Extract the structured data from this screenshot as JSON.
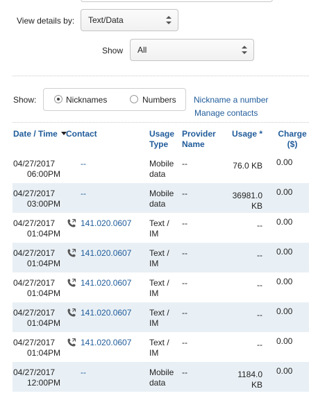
{
  "filters": {
    "view_details_label": "View details by:",
    "view_details_value": "Text/Data",
    "show_label": "Show",
    "show_value": "All"
  },
  "display": {
    "show_label": "Show:",
    "option_nicknames": "Nicknames",
    "option_numbers": "Numbers",
    "selected": "Nicknames",
    "link_nickname": "Nickname a number",
    "link_manage": "Manage contacts"
  },
  "table": {
    "headers": {
      "date_time": "Date / Time",
      "contact": "Contact",
      "usage_type_1": "Usage",
      "usage_type_2": "Type",
      "provider_1": "Provider",
      "provider_2": "Name",
      "usage": "Usage *",
      "charge_1": "Charge",
      "charge_2": "($)"
    },
    "rows": [
      {
        "date": "04/27/2017",
        "time": "06:00PM",
        "contact": "--",
        "type_1": "Mobile",
        "type_2": "data",
        "provider": "--",
        "usage_1": "76.0 KB",
        "usage_2": "",
        "charge": "0.00",
        "phone": false
      },
      {
        "date": "04/27/2017",
        "time": "03:00PM",
        "contact": "--",
        "type_1": "Mobile",
        "type_2": "data",
        "provider": "--",
        "usage_1": "36981.0",
        "usage_2": "KB",
        "charge": "0.00",
        "phone": false
      },
      {
        "date": "04/27/2017",
        "time": "01:04PM",
        "contact": "141.020.0607",
        "type_1": "Text /",
        "type_2": "IM",
        "provider": "--",
        "usage_1": "--",
        "usage_2": "",
        "charge": "0.00",
        "phone": true
      },
      {
        "date": "04/27/2017",
        "time": "01:04PM",
        "contact": "141.020.0607",
        "type_1": "Text /",
        "type_2": "IM",
        "provider": "--",
        "usage_1": "--",
        "usage_2": "",
        "charge": "0.00",
        "phone": true
      },
      {
        "date": "04/27/2017",
        "time": "01:04PM",
        "contact": "141.020.0607",
        "type_1": "Text /",
        "type_2": "IM",
        "provider": "--",
        "usage_1": "--",
        "usage_2": "",
        "charge": "0.00",
        "phone": true
      },
      {
        "date": "04/27/2017",
        "time": "01:04PM",
        "contact": "141.020.0607",
        "type_1": "Text /",
        "type_2": "IM",
        "provider": "--",
        "usage_1": "--",
        "usage_2": "",
        "charge": "0.00",
        "phone": true
      },
      {
        "date": "04/27/2017",
        "time": "01:04PM",
        "contact": "141.020.0607",
        "type_1": "Text /",
        "type_2": "IM",
        "provider": "--",
        "usage_1": "--",
        "usage_2": "",
        "charge": "0.00",
        "phone": true
      },
      {
        "date": "04/27/2017",
        "time": "12:00PM",
        "contact": "--",
        "type_1": "Mobile",
        "type_2": "data",
        "provider": "--",
        "usage_1": "1184.0",
        "usage_2": "KB",
        "charge": "0.00",
        "phone": false
      }
    ]
  },
  "colors": {
    "link": "#1f5b9a",
    "alt_row": "#e9f0f5"
  }
}
